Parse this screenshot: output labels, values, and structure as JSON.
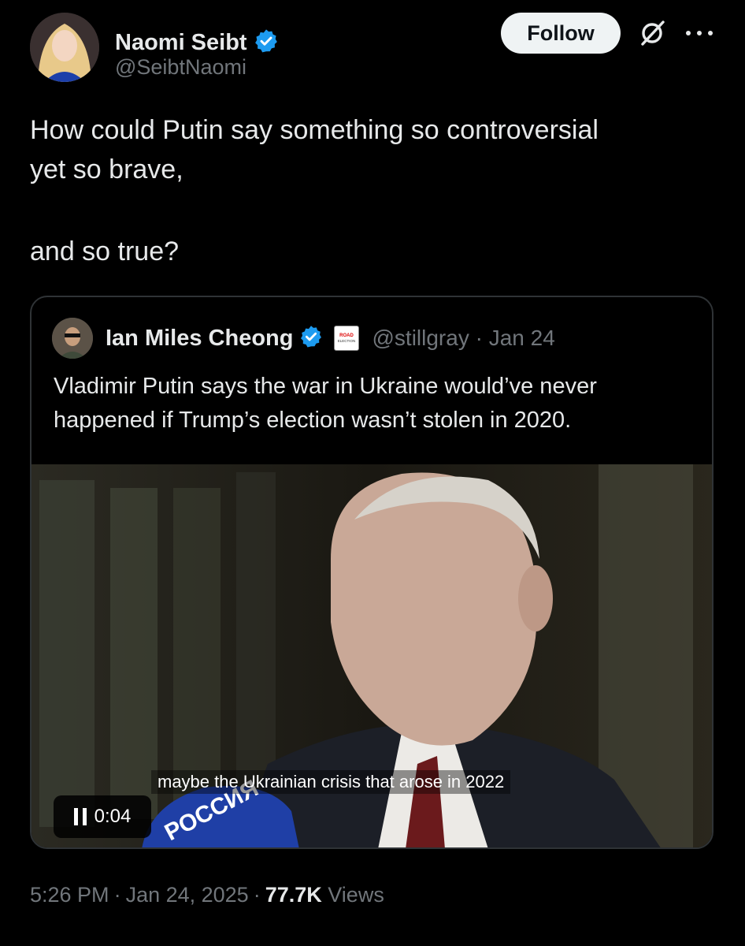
{
  "author": {
    "name": "Naomi Seibt",
    "handle": "@SeibtNaomi"
  },
  "follow_label": "Follow",
  "tweet": {
    "line1": "How could Putin say something so controversial",
    "line2": "yet so brave,",
    "line3": "and so true?"
  },
  "quoted": {
    "name": "Ian Miles Cheong",
    "meta": "@stillgray · Jan 24",
    "text": "Vladimir Putin says the war in Ukraine would’ve never happened if Trump’s election wasn’t stolen in 2020.",
    "badge_text": "ROAD ELECTION"
  },
  "video": {
    "caption": "maybe the Ukrainian crisis that arose in 2022",
    "time": "0:04",
    "mic_text": "РОССИЯ"
  },
  "footer": {
    "time": "5:26 PM",
    "date": "Jan 24, 2025",
    "views_count": "77.7K",
    "views_label": "Views"
  },
  "colors": {
    "background": "#000000",
    "text": "#e7e9ea",
    "muted": "#71767b",
    "verified": "#1d9bf0",
    "border": "#2f3336"
  }
}
